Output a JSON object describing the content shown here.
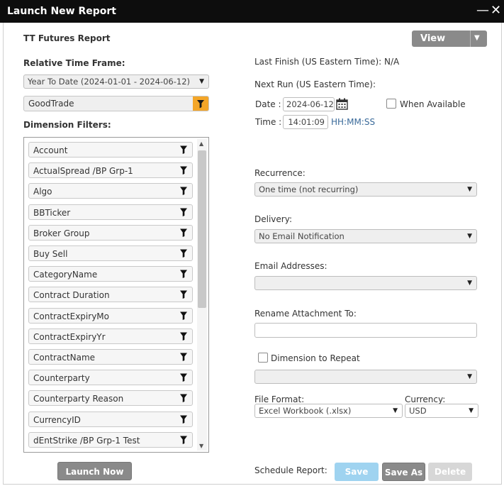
{
  "window": {
    "title": "Launch New Report",
    "minimize_glyph": "—",
    "close_glyph": "✕"
  },
  "report_name": "TT Futures Report",
  "view_button": {
    "label": "View"
  },
  "relative_time_frame": {
    "label": "Relative Time Frame:",
    "selected": "Year To Date (2024-01-01 - 2024-06-12)"
  },
  "account_filter": {
    "value": "GoodTrade",
    "icon": "filter-icon"
  },
  "dimension_filters": {
    "label": "Dimension Filters:",
    "items": [
      "Account",
      "ActualSpread /BP Grp-1",
      "Algo",
      "BBTicker",
      "Broker Group",
      "Buy Sell",
      "CategoryName",
      "Contract Duration",
      "ContractExpiryMo",
      "ContractExpiryYr",
      "ContractName",
      "Counterparty",
      "Counterparty Reason",
      "CurrencyID",
      "dEntStrike /BP Grp-1 Test"
    ]
  },
  "last_finish": {
    "label": "Last Finish (US Eastern Time): N/A"
  },
  "next_run": {
    "label": "Next Run (US Eastern Time):",
    "date_label": "Date :",
    "date_value": "2024-06-12",
    "when_available_label": "When Available",
    "time_label": "Time :",
    "time_value": "14:01:09",
    "time_format": "HH:MM:SS"
  },
  "recurrence": {
    "label": "Recurrence:",
    "selected": "One time (not recurring)"
  },
  "delivery": {
    "label": "Delivery:",
    "selected": "No Email Notification"
  },
  "email_addresses": {
    "label": "Email Addresses:",
    "selected": ""
  },
  "rename_attachment": {
    "label": "Rename Attachment To:",
    "value": ""
  },
  "dimension_to_repeat": {
    "label": "Dimension to Repeat",
    "selected": ""
  },
  "file_format": {
    "label": "File Format:",
    "selected": "Excel Workbook (.xlsx)"
  },
  "currency": {
    "label": "Currency:",
    "selected": "USD"
  },
  "buttons": {
    "launch_now": "Launch Now",
    "schedule_label": "Schedule Report:",
    "save": "Save",
    "save_as": "Save As",
    "delete": "Delete"
  },
  "colors": {
    "titlebar": "#0d0d0d",
    "filter_accent": "#f4a628",
    "save_button": "#9fd3f0",
    "dark_button": "#8a8a8a",
    "time_format_text": "#3a6a9a"
  }
}
